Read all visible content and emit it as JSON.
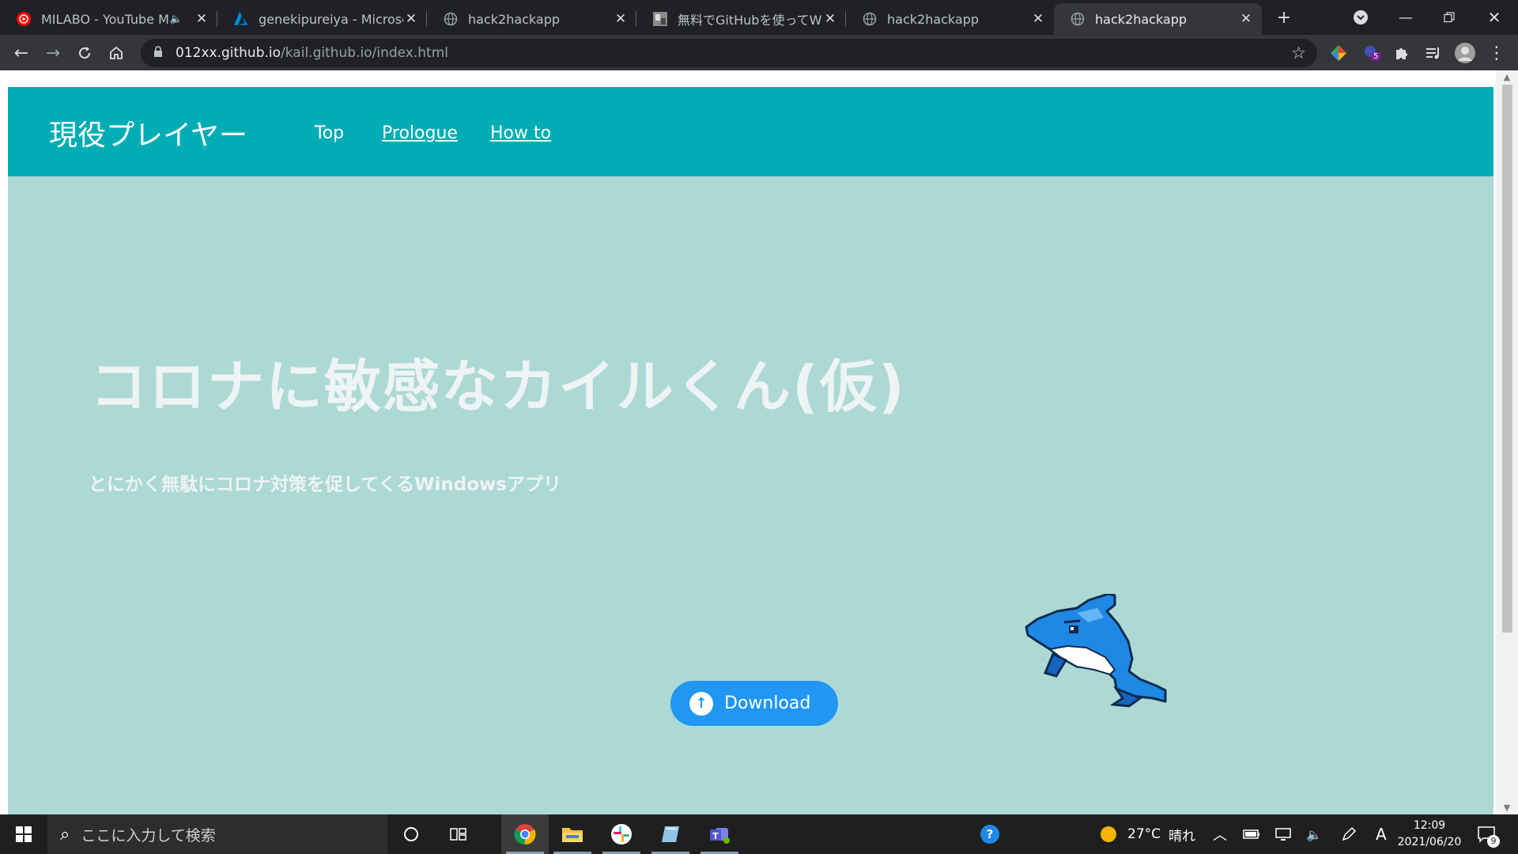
{
  "browser": {
    "tabs": [
      {
        "title": "MILABO - YouTube Music",
        "favicon": "youtube-music-icon",
        "audio": true,
        "active": false
      },
      {
        "title": "genekipureiya - Microsoft Azure",
        "favicon": "azure-icon",
        "active": false
      },
      {
        "title": "hack2hackapp",
        "favicon": "globe-icon",
        "active": false
      },
      {
        "title": "無料でGitHubを使ってWEBサイト",
        "favicon": "thumbnail-icon",
        "active": false
      },
      {
        "title": "hack2hackapp",
        "favicon": "globe-icon",
        "active": false
      },
      {
        "title": "hack2hackapp",
        "favicon": "globe-icon",
        "active": true
      }
    ],
    "new_tab_glyph": "+",
    "url_host": "012xx.github.io",
    "url_path": "/kail.github.io/index.html",
    "extension_badge": "5"
  },
  "site": {
    "brand": "現役プレイヤー",
    "nav": [
      "Top",
      "Prologue",
      "How to"
    ],
    "hero_title": "コロナに敏感なカイルくん(仮)",
    "hero_subtitle": "とにかく無駄にコロナ対策を促してくるWindowsアプリ",
    "download_label": "Download",
    "colors": {
      "header": "#00adb5",
      "background": "#acd9d4",
      "button": "#2196f3"
    }
  },
  "taskbar": {
    "search_placeholder": "ここに入力して検索",
    "weather_temp": "27°C",
    "weather_text": "晴れ",
    "ime": "A",
    "time": "12:09",
    "date": "2021/06/20",
    "notifications": "9"
  }
}
